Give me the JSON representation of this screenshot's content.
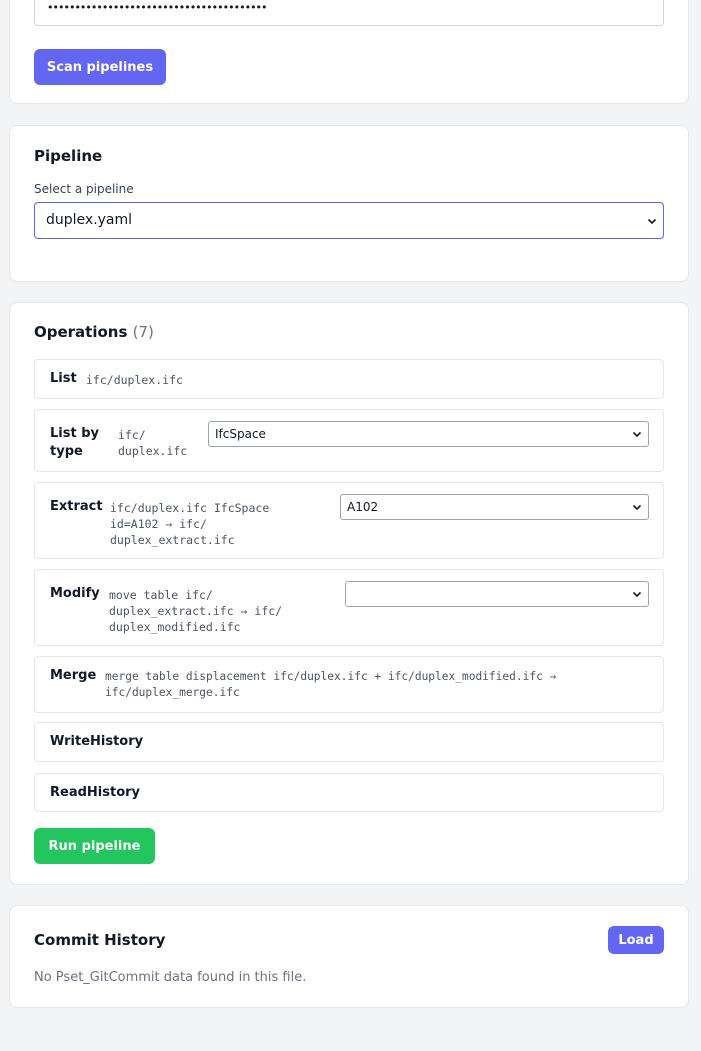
{
  "credentials": {
    "masked_value": "••••••••••••••••••••••••••••••••••••••••",
    "scan_button": "Scan pipelines"
  },
  "pipeline": {
    "title": "Pipeline",
    "select_label": "Select a pipeline",
    "selected": "duplex.yaml"
  },
  "operations": {
    "title": "Operations",
    "count": "(7)",
    "items": [
      {
        "name": "List",
        "detail": "ifc/duplex.ifc"
      },
      {
        "name_line1": "List by",
        "name_line2": "type",
        "detail_line1": "ifc/",
        "detail_line2": "duplex.ifc",
        "select_value": "IfcSpace"
      },
      {
        "name": "Extract",
        "detail_line1": "ifc/duplex.ifc IfcSpace",
        "detail_line2": "id=A102 → ifc/",
        "detail_line3": "duplex_extract.ifc",
        "select_value": "A102"
      },
      {
        "name": "Modify",
        "detail_line1": "move table ifc/",
        "detail_line2": "duplex_extract.ifc → ifc/",
        "detail_line3": "duplex_modified.ifc",
        "select_value": ""
      },
      {
        "name": "Merge",
        "detail_line1": "merge table displacement ifc/duplex.ifc + ifc/duplex_modified.ifc →",
        "detail_line2": "ifc/duplex_merge.ifc"
      },
      {
        "name": "WriteHistory"
      },
      {
        "name": "ReadHistory"
      }
    ],
    "run_button": "Run pipeline"
  },
  "commit_history": {
    "title": "Commit History",
    "load_button": "Load",
    "empty_message": "No Pset_GitCommit data found in this file."
  },
  "colors": {
    "accent": "#6366f1",
    "run": "#22c55e",
    "background": "#f3f4f6",
    "card": "#ffffff",
    "border": "#e5e7eb"
  },
  "icons": {
    "select_chevron": "chevron-down-icon"
  }
}
